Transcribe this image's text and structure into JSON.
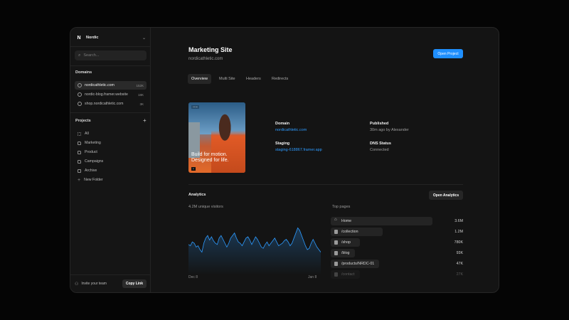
{
  "workspace": {
    "name": "Nordic",
    "logo": "N"
  },
  "search": {
    "placeholder": "Search..."
  },
  "domains": {
    "title": "Domains",
    "items": [
      {
        "label": "nordicathletic.com",
        "count": "152K",
        "active": true
      },
      {
        "label": "nordic-blog.framer.website",
        "count": "18K",
        "active": false
      },
      {
        "label": "shop.nordicathletic.com",
        "count": "3K",
        "active": false
      }
    ]
  },
  "projects": {
    "title": "Projects",
    "add_icon": "plus-icon",
    "items": [
      {
        "label": "All",
        "icon": "grid-icon"
      },
      {
        "label": "Marketing",
        "icon": "folder-icon"
      },
      {
        "label": "Product",
        "icon": "folder-icon"
      },
      {
        "label": "Campaigns",
        "icon": "folder-icon"
      },
      {
        "label": "Archive",
        "icon": "archive-icon"
      },
      {
        "label": "New Folder",
        "icon": "plus-icon"
      }
    ]
  },
  "footer": {
    "invite_label": "Invite your team",
    "copy_label": "Copy Link"
  },
  "page": {
    "title": "Marketing Site",
    "subtitle": "nordicathletic.com",
    "open_button": "Open Project",
    "tabs": [
      "Overview",
      "Multi Site",
      "Headers",
      "Redirects"
    ],
    "active_tab": "Overview"
  },
  "hero": {
    "tagline": "Build for motion. Designed for life."
  },
  "details": {
    "domain_label": "Domain",
    "domain_value": "nordicathletic.com",
    "staging_label": "Staging",
    "staging_value": "staging-618867.framer.app",
    "published_label": "Published",
    "published_value": "30m ago by Alexander",
    "dns_label": "DNS Status",
    "dns_value": "Connected"
  },
  "analytics": {
    "title": "Analytics",
    "open_button": "Open Analytics",
    "visitors": "4.2M unique visitors",
    "x_start": "Dec 8",
    "x_end": "Jan 8",
    "top_pages_title": "Top pages",
    "top_pages": [
      {
        "path": "Home",
        "value": "3.6M",
        "share": 0.77,
        "icon": "home-icon"
      },
      {
        "path": "/collection",
        "value": "1.2M",
        "share": 0.39,
        "icon": "file-icon"
      },
      {
        "path": "/shop",
        "value": "780K",
        "share": 0.22,
        "icon": "file-icon"
      },
      {
        "path": "/blog",
        "value": "93K",
        "share": 0.16,
        "icon": "file-icon"
      },
      {
        "path": "/products/NRDC-01",
        "value": "47K",
        "share": 0.0,
        "icon": "file-icon"
      },
      {
        "path": "/contact",
        "value": "27K",
        "share": 0.0,
        "icon": "file-icon"
      }
    ]
  },
  "chart_data": {
    "type": "area",
    "x": [
      "Dec 8",
      "Jan 8"
    ],
    "series": [
      {
        "values": [
          48,
          46,
          52,
          50,
          44,
          46,
          40,
          36,
          50,
          58,
          62,
          55,
          60,
          54,
          50,
          48,
          58,
          62,
          56,
          50,
          44,
          50,
          58,
          62,
          66,
          58,
          52,
          50,
          46,
          52,
          58,
          60,
          55,
          48,
          54,
          60,
          56,
          50,
          44,
          42,
          48,
          52,
          46,
          50,
          54,
          58,
          52,
          46,
          48,
          50,
          54,
          56,
          52,
          46,
          50,
          58,
          66,
          74,
          70,
          62,
          54,
          46,
          40,
          42,
          50,
          56,
          50,
          44,
          40,
          36
        ]
      }
    ],
    "ylim": [
      0,
      100
    ],
    "color": "#2d9bff"
  }
}
